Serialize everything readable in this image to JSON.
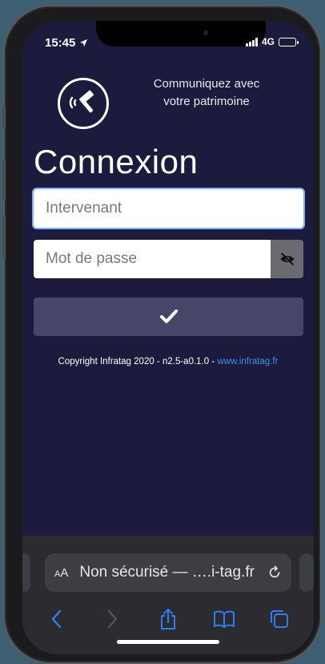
{
  "status": {
    "time": "15:45",
    "network": "4G",
    "battery_level": 0.85
  },
  "header": {
    "tagline_line1": "Communiquez avec",
    "tagline_line2": "votre patrimoine"
  },
  "login": {
    "title": "Connexion",
    "user_placeholder": "Intervenant",
    "password_placeholder": "Mot de passe"
  },
  "footer": {
    "copyright": "Copyright Infratag 2020 - n2.5-a0.1.0 - ",
    "link": "www.infratag.fr"
  },
  "safari": {
    "aa_small": "A",
    "aa_large": "A",
    "url": "Non sécurisé — ….i-tag.fr"
  },
  "colors": {
    "background": "#1c1b3d",
    "button": "#454668",
    "link": "#3d8fe6",
    "safari_blue": "#2f7cf6"
  },
  "icons": [
    "location-arrow-icon",
    "signal-icon",
    "battery-icon",
    "infratag-logo-icon",
    "eye-slash-icon",
    "checkmark-icon",
    "reload-icon",
    "back-icon",
    "forward-icon",
    "share-icon",
    "bookmarks-icon",
    "tabs-icon"
  ]
}
